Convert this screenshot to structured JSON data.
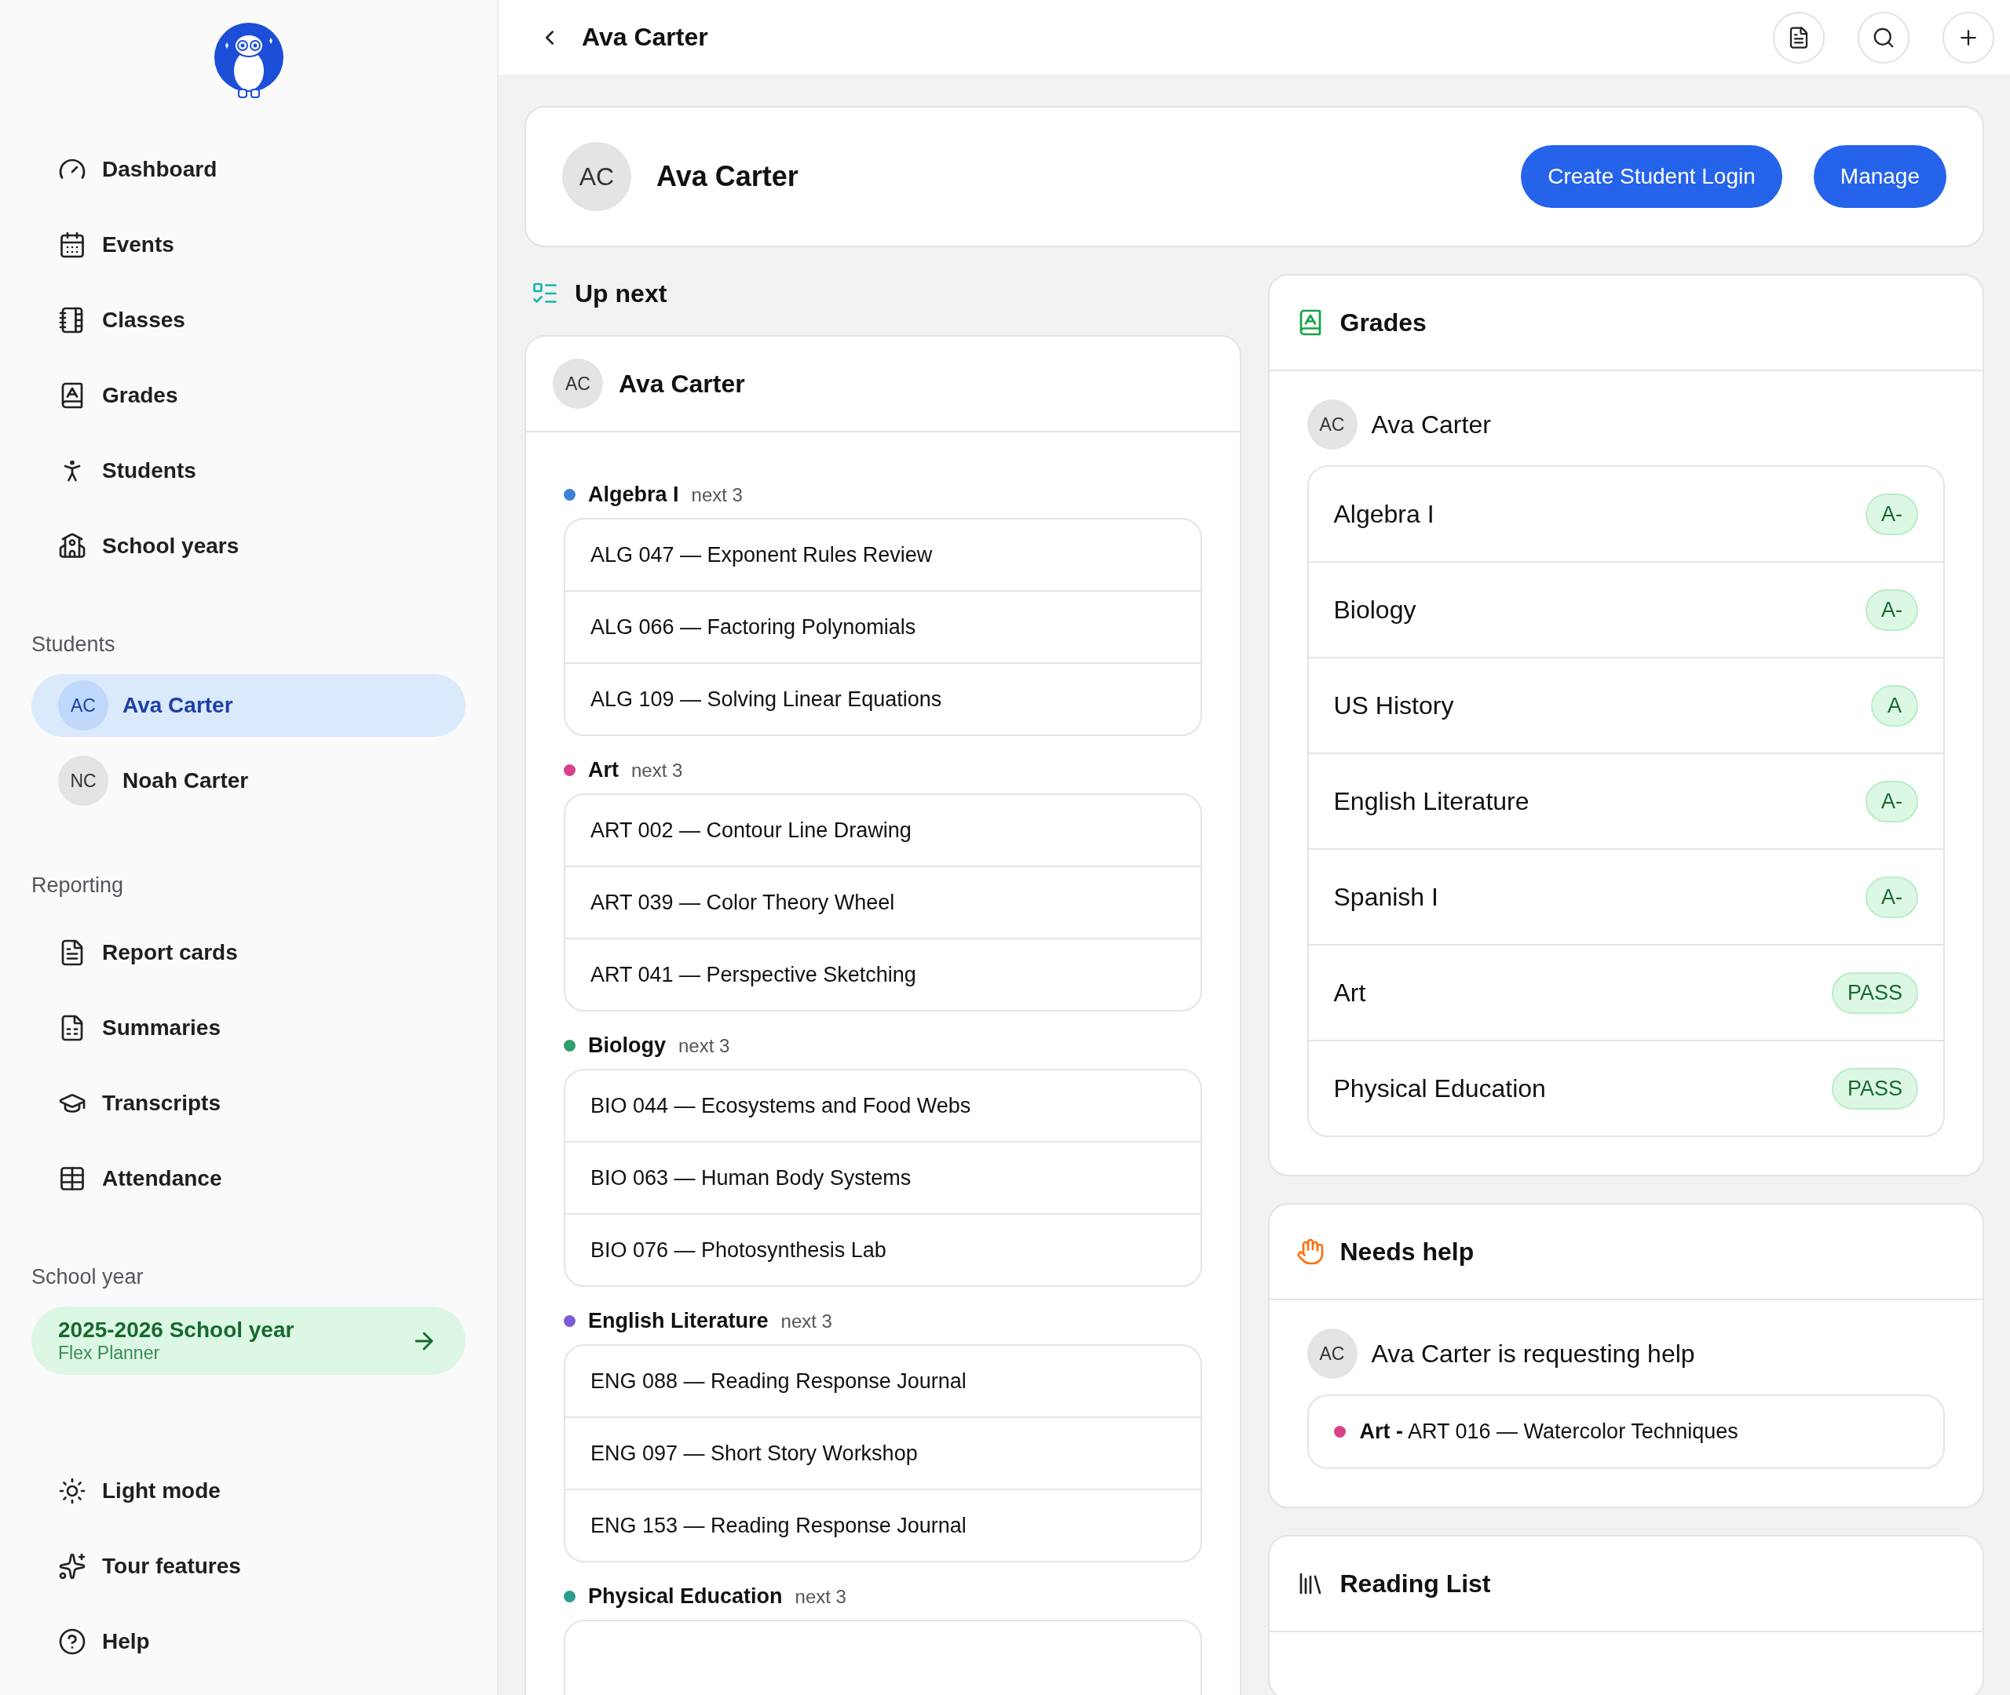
{
  "sidebar": {
    "nav": [
      "Dashboard",
      "Events",
      "Classes",
      "Grades",
      "Students",
      "School years"
    ],
    "students_heading": "Students",
    "students": [
      {
        "initials": "AC",
        "name": "Ava Carter",
        "selected": true
      },
      {
        "initials": "NC",
        "name": "Noah Carter",
        "selected": false
      }
    ],
    "reporting_heading": "Reporting",
    "reporting": [
      "Report cards",
      "Summaries",
      "Transcripts",
      "Attendance"
    ],
    "school_year_heading": "School year",
    "school_year": {
      "title": "2025-2026 School year",
      "subtitle": "Flex Planner"
    },
    "footer": [
      "Light mode",
      "Tour features",
      "Help"
    ]
  },
  "topbar": {
    "title": "Ava Carter"
  },
  "profile": {
    "initials": "AC",
    "name": "Ava Carter",
    "buttons": [
      "Create Student Login",
      "Manage"
    ]
  },
  "up_next": {
    "title": "Up next",
    "student": {
      "initials": "AC",
      "name": "Ava Carter"
    },
    "classes": [
      {
        "name": "Algebra I",
        "count": "next 3",
        "color": "#3b82d6",
        "lessons": [
          "ALG 047 — Exponent Rules Review",
          "ALG 066 — Factoring Polynomials",
          "ALG 109 — Solving Linear Equations"
        ]
      },
      {
        "name": "Art",
        "count": "next 3",
        "color": "#d9428a",
        "lessons": [
          "ART 002 — Contour Line Drawing",
          "ART 039 — Color Theory Wheel",
          "ART 041 — Perspective Sketching"
        ]
      },
      {
        "name": "Biology",
        "count": "next 3",
        "color": "#2f9e6e",
        "lessons": [
          "BIO 044 — Ecosystems and Food Webs",
          "BIO 063 — Human Body Systems",
          "BIO 076 — Photosynthesis Lab"
        ]
      },
      {
        "name": "English Literature",
        "count": "next 3",
        "color": "#7c5cd6",
        "lessons": [
          "ENG 088 — Reading Response Journal",
          "ENG 097 — Short Story Workshop",
          "ENG 153 — Reading Response Journal"
        ]
      },
      {
        "name": "Physical Education",
        "count": "next 3",
        "color": "#2a9d8f"
      }
    ]
  },
  "grades": {
    "title": "Grades",
    "student": {
      "initials": "AC",
      "name": "Ava Carter"
    },
    "rows": [
      {
        "subject": "Algebra I",
        "grade": "A-"
      },
      {
        "subject": "Biology",
        "grade": "A-"
      },
      {
        "subject": "US History",
        "grade": "A"
      },
      {
        "subject": "English Literature",
        "grade": "A-"
      },
      {
        "subject": "Spanish I",
        "grade": "A-"
      },
      {
        "subject": "Art",
        "grade": "PASS"
      },
      {
        "subject": "Physical Education",
        "grade": "PASS"
      }
    ]
  },
  "needs_help": {
    "title": "Needs help",
    "initials": "AC",
    "message": "Ava Carter is requesting help",
    "request": {
      "color": "#d9428a",
      "text": "**Art -** ART 016 — Watercolor Techniques"
    }
  },
  "reading_list": {
    "title": "Reading List"
  }
}
